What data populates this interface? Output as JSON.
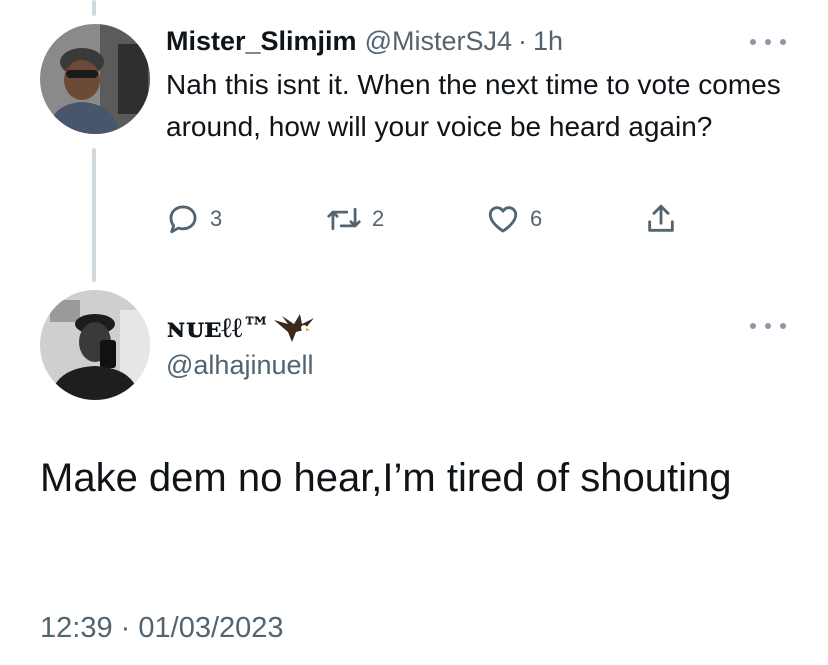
{
  "reply": {
    "display_name": "Mister_Slimjim",
    "handle": "@MisterSJ4",
    "separator": "·",
    "time": "1h",
    "text": "Nah this isnt it. When the next time to vote comes around, how will your voice be heard again?",
    "reply_count": "3",
    "retweet_count": "2",
    "like_count": "6",
    "more_icon": "more-horizontal-icon"
  },
  "main_tweet": {
    "display_name": "ɴᴜᴇℓℓ™",
    "badge_icon": "eagle-icon",
    "handle": "@alhajinuell",
    "text": "Make dem no hear,I’m tired of shouting",
    "time": "12:39",
    "separator": "·",
    "date": "01/03/2023"
  },
  "colors": {
    "text_primary": "#0f1419",
    "text_secondary": "#536471",
    "thread_line": "#cfd9de",
    "icon_accent": "#1d9bf0"
  }
}
